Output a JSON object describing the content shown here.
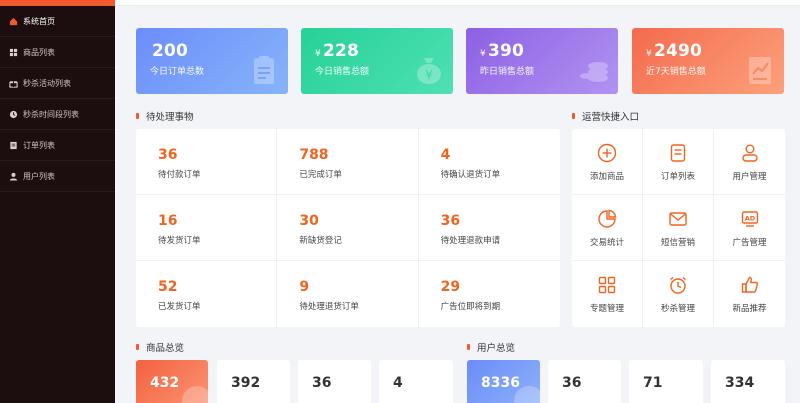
{
  "colors": {
    "accent": "#f25a2b",
    "sidebar_bg": "#1c0e0e",
    "number_orange": "#f0641f"
  },
  "sidebar": {
    "items": [
      {
        "label": "系统首页",
        "icon": "home-icon"
      },
      {
        "label": "商品列表",
        "icon": "grid-icon"
      },
      {
        "label": "秒杀活动列表",
        "icon": "gift-icon"
      },
      {
        "label": "秒杀时间段列表",
        "icon": "clock-icon"
      },
      {
        "label": "订单列表",
        "icon": "document-icon"
      },
      {
        "label": "用户列表",
        "icon": "user-icon"
      }
    ]
  },
  "stats": [
    {
      "currency": "",
      "value": "200",
      "label": "今日订单总数",
      "icon": "clipboard-icon"
    },
    {
      "currency": "¥",
      "value": "228",
      "label": "今日销售总额",
      "icon": "money-bag-icon"
    },
    {
      "currency": "¥",
      "value": "390",
      "label": "昨日销售总额",
      "icon": "coins-icon"
    },
    {
      "currency": "¥",
      "value": "2490",
      "label": "近7天销售总额",
      "icon": "trend-report-icon"
    }
  ],
  "todo": {
    "title": "待处理事物",
    "items": [
      {
        "value": "36",
        "label": "待付款订单"
      },
      {
        "value": "788",
        "label": "已完成订单"
      },
      {
        "value": "4",
        "label": "待确认退货订单"
      },
      {
        "value": "16",
        "label": "待发货订单"
      },
      {
        "value": "30",
        "label": "新缺货登记"
      },
      {
        "value": "36",
        "label": "待处理退款申请"
      },
      {
        "value": "52",
        "label": "已发货订单"
      },
      {
        "value": "9",
        "label": "待处理退货订单"
      },
      {
        "value": "29",
        "label": "广告位即将到期"
      }
    ]
  },
  "quick": {
    "title": "运营快捷入口",
    "items": [
      {
        "label": "添加商品",
        "icon": "plus-circle-icon"
      },
      {
        "label": "订单列表",
        "icon": "order-list-icon"
      },
      {
        "label": "用户管理",
        "icon": "user-manage-icon"
      },
      {
        "label": "交易统计",
        "icon": "pie-chart-icon"
      },
      {
        "label": "短信营销",
        "icon": "mail-icon"
      },
      {
        "label": "广告管理",
        "icon": "ad-icon"
      },
      {
        "label": "专题管理",
        "icon": "grid-squares-icon"
      },
      {
        "label": "秒杀管理",
        "icon": "alarm-clock-icon"
      },
      {
        "label": "新品推荐",
        "icon": "thumbs-up-icon"
      }
    ]
  },
  "goods_overview": {
    "title": "商品总览",
    "cards": [
      {
        "value": "432"
      },
      {
        "value": "392"
      },
      {
        "value": "36"
      },
      {
        "value": "4"
      }
    ]
  },
  "user_overview": {
    "title": "用户总览",
    "cards": [
      {
        "value": "8336"
      },
      {
        "value": "36"
      },
      {
        "value": "71"
      },
      {
        "value": "334"
      }
    ]
  }
}
